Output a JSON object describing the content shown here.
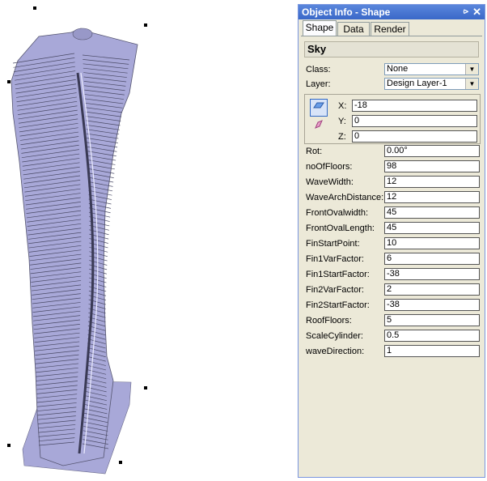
{
  "palette": {
    "title": "Object Info - Shape",
    "pin_glyph": "⪧",
    "close_glyph": "✕",
    "tabs": [
      "Shape",
      "Data",
      "Render"
    ],
    "active_tab": "Shape",
    "shape_name": "Sky",
    "class_label": "Class:",
    "class_value": "None",
    "layer_label": "Layer:",
    "layer_value": "Design Layer-1",
    "x_label": "X:",
    "x_value": "-18",
    "y_label": "Y:",
    "y_value": "0",
    "z_label": "Z:",
    "z_value": "0",
    "params": [
      {
        "label": "Rot:",
        "value": "0.00°"
      },
      {
        "label": "noOfFloors:",
        "value": "98"
      },
      {
        "label": "WaveWidth:",
        "value": "12"
      },
      {
        "label": "WaveArchDistance:",
        "value": "12"
      },
      {
        "label": "FrontOvalwidth:",
        "value": "45"
      },
      {
        "label": "FrontOvalLength:",
        "value": "45"
      },
      {
        "label": "FinStartPoint:",
        "value": "10"
      },
      {
        "label": "Fin1VarFactor:",
        "value": "6"
      },
      {
        "label": "Fin1StartFactor:",
        "value": "-38"
      },
      {
        "label": "Fin2VarFactor:",
        "value": "2"
      },
      {
        "label": "Fin2StartFactor:",
        "value": "-38"
      },
      {
        "label": "RoofFloors:",
        "value": "5"
      },
      {
        "label": "ScaleCylinder:",
        "value": "0.5"
      },
      {
        "label": "waveDirection:",
        "value": "1"
      }
    ]
  },
  "colors": {
    "tower_fill": "#a8a8d8",
    "tower_dark": "#5a5a7a",
    "palette_bg": "#ece9d8",
    "title_bar": "#3a68c8"
  }
}
